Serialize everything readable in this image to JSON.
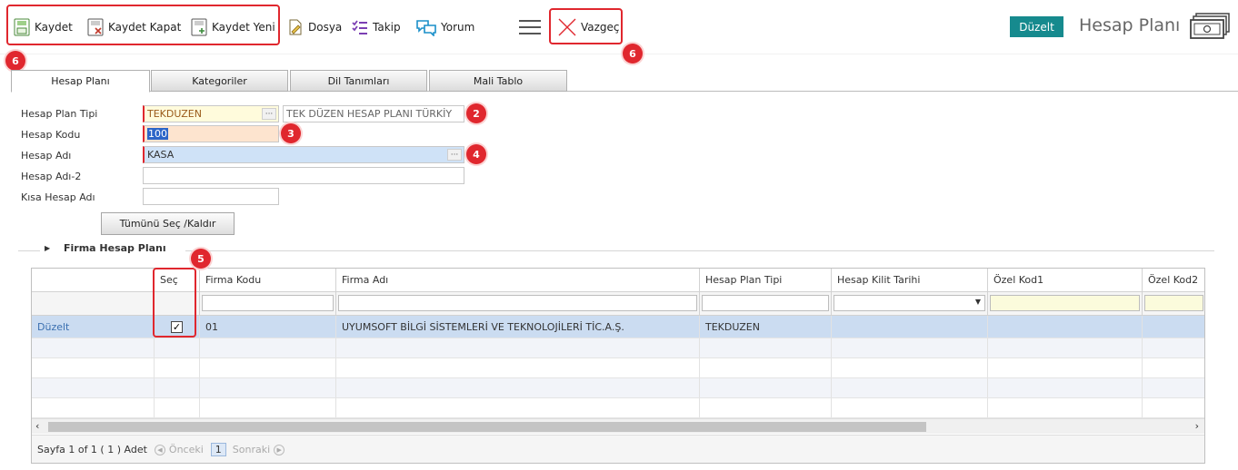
{
  "toolbar": {
    "save_label": "Kaydet",
    "save_close_label": "Kaydet Kapat",
    "save_new_label": "Kaydet Yeni",
    "file_label": "Dosya",
    "track_label": "Takip",
    "comment_label": "Yorum",
    "cancel_label": "Vazgeç",
    "mode_badge": "Düzelt",
    "page_title": "Hesap Planı"
  },
  "annotations": {
    "b_save": "6",
    "b_tabs": "6",
    "b_plantype": "2",
    "b_code": "3",
    "b_name": "4",
    "b_select": "5"
  },
  "tabs": [
    {
      "label": "Hesap Planı"
    },
    {
      "label": "Kategoriler"
    },
    {
      "label": "Dil Tanımları"
    },
    {
      "label": "Mali Tablo"
    }
  ],
  "form": {
    "plan_type_label": "Hesap Plan Tipi",
    "plan_type_value": "TEKDUZEN",
    "plan_type_desc": "TEK DÜZEN HESAP PLANI TÜRKİY",
    "code_label": "Hesap Kodu",
    "code_value": "100",
    "name_label": "Hesap Adı",
    "name_value": "KASA",
    "name2_label": "Hesap Adı-2",
    "name2_value": "",
    "short_label": "Kısa Hesap Adı",
    "short_value": "",
    "select_all_button": "Tümünü Seç /Kaldır"
  },
  "section": {
    "title": "Firma Hesap Planı"
  },
  "grid": {
    "columns": [
      "Seç",
      "Firma Kodu",
      "Firma Adı",
      "Hesap Plan Tipi",
      "Hesap Kilit Tarihi",
      "Özel Kod1",
      "Özel Kod2"
    ],
    "rows": [
      {
        "action": "Düzelt",
        "selected": true,
        "firm_code": "01",
        "firm_name": "UYUMSOFT BİLGİ SİSTEMLERİ VE TEKNOLOJİLERİ TİC.A.Ş.",
        "plan_type": "TEKDUZEN"
      }
    ]
  },
  "pager": {
    "info": "Sayfa 1 of 1 ( 1 ) Adet",
    "prev": "Önceki",
    "page": "1",
    "next": "Sonraki"
  },
  "colors": {
    "highlight": "#e0272e",
    "accent": "#168a8e",
    "selected_row": "#cbdcf1",
    "required_field": "#fffbdc",
    "code_field": "#fde4cf"
  }
}
